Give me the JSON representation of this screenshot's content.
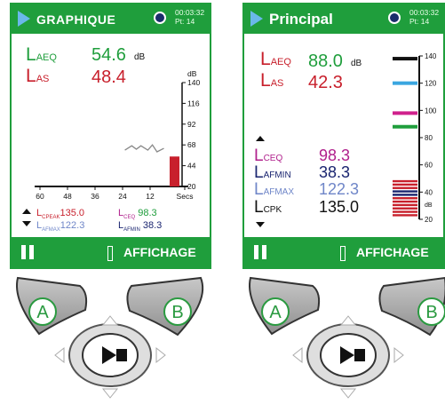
{
  "left": {
    "title": "GRAPHIQUE",
    "clock": "00:03:32",
    "point": "Pt: 14",
    "laeq_label": "L",
    "laeq_sub": "AEQ",
    "laeq_value": "54.6",
    "laeq_unit": "dB",
    "las_label": "L",
    "las_sub": "AS",
    "las_value": "48.4",
    "db_label": "dB",
    "y_ticks": [
      "140",
      "116",
      "92",
      "68",
      "44",
      "20"
    ],
    "x_ticks": [
      "60",
      "48",
      "36",
      "24",
      "12",
      "Secs"
    ],
    "cpeak_sub": "CPEAK",
    "cpeak_value": "135.0",
    "afmax_sub": "AFMAX",
    "afmax_value": "122.3",
    "ceq_sub": "CEQ",
    "ceq_value": "98.3",
    "afmin_sub": "AFMIN",
    "afmin_value": "38.3",
    "footer_label": "AFFICHAGE"
  },
  "right": {
    "title": "Principal",
    "clock": "00:03:32",
    "point": "Pt: 14",
    "laeq_sub": "AEQ",
    "laeq_value": "88.0",
    "laeq_unit": "dB",
    "las_sub": "AS",
    "las_value": "42.3",
    "ceq_sub": "CEQ",
    "ceq_value": "98.3",
    "afmin_sub": "AFMIN",
    "afmin_value": "38.3",
    "afmax_sub": "AFMAX",
    "afmax_value": "122.3",
    "cpk_sub": "CPK",
    "cpk_value": "135.0",
    "scale_ticks": [
      "140",
      "120",
      "100",
      "80",
      "60",
      "40",
      "20"
    ],
    "scale_unit": "dB",
    "footer_label": "AFFICHAGE"
  },
  "controls": {
    "button_a": "A",
    "button_b": "B"
  },
  "colors": {
    "header_green": "#1f9e3c",
    "red": "#c8202c",
    "blue_marker": "#3aa6e0",
    "magenta_marker": "#d0208c",
    "green_marker": "#1f9e3c"
  },
  "chart_data": {
    "type": "line",
    "xlabel": "Secs",
    "x_ticks": [
      60,
      48,
      36,
      24,
      12
    ],
    "ylabel": "dB",
    "ylim": [
      20,
      140
    ],
    "y_ticks": [
      140,
      116,
      92,
      68,
      44,
      20
    ],
    "series": [
      {
        "values": [
          [
            23,
            62
          ],
          [
            20,
            67
          ],
          [
            18,
            63
          ],
          [
            16,
            67
          ],
          [
            13,
            62
          ],
          [
            11,
            68
          ],
          [
            9,
            60
          ],
          [
            6,
            64
          ]
        ]
      }
    ],
    "current_bar": 54.6
  }
}
